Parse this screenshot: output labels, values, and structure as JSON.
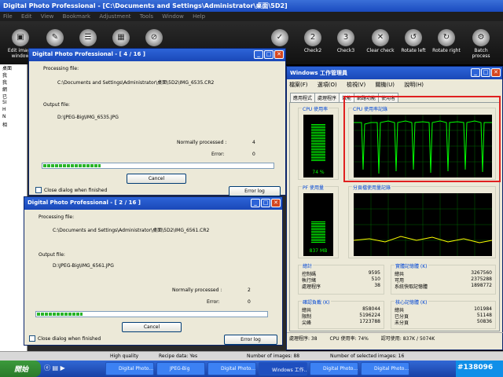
{
  "app": {
    "title": "Digital Photo Professional - [C:\\Documents and Settings\\Administrator\\桌面\\5D2]",
    "menu": [
      "File",
      "Edit",
      "View",
      "Bookmark",
      "Adjustment",
      "Tools",
      "Window",
      "Help"
    ]
  },
  "toolbar": {
    "edit_image": "Edit image window",
    "check2": "Check2",
    "check3": "Check3",
    "clear_check": "Clear check",
    "rotate_left": "Rotate left",
    "rotate_right": "Rotate right",
    "batch_process": "Batch process"
  },
  "folder_tree": [
    "桌面",
    "我",
    "我",
    "網",
    "已",
    "5I",
    "H",
    "N",
    "相"
  ],
  "dialog1": {
    "title": "Digital Photo Professional - [ 4 / 16 ]",
    "processing_label": "Processing file:",
    "processing_path": "C:\\Documents and Settings\\Administrator\\桌面\\5D2\\IMG_6535.CR2",
    "output_label": "Output file:",
    "output_path": "D:\\JPEG-Big\\IMG_6535.JPG",
    "normally_label": "Normally processed :",
    "normally_value": "4",
    "error_label": "Error:",
    "error_value": "0",
    "progress": 0.25,
    "cancel": "Cancel",
    "close_label": "Close dialog when finished",
    "error_log": "Error log"
  },
  "dialog2": {
    "title": "Digital Photo Professional - [ 2 / 16 ]",
    "processing_label": "Processing file:",
    "processing_path": "C:\\Documents and Settings\\Administrator\\桌面\\5D2\\IMG_6561.CR2",
    "output_label": "Output file:",
    "output_path": "D:\\JPEG-Big\\IMG_6561.JPG",
    "normally_label": "Normally processed :",
    "normally_value": "2",
    "error_label": "Error:",
    "error_value": "0",
    "progress": 0.2,
    "cancel": "Cancel",
    "close_label": "Close dialog when finished",
    "error_log": "Error log"
  },
  "taskmgr": {
    "title": "Windows 工作管理員",
    "menu": [
      "檔案(F)",
      "選項(O)",
      "檢視(V)",
      "關機(U)",
      "說明(H)"
    ],
    "tabs": [
      "應用程式",
      "處理程序",
      "效能",
      "網路功能",
      "使用者"
    ],
    "cpu_usage_label": "CPU 使用率",
    "cpu_usage_value": "74 %",
    "cpu_history_label": "CPU 使用率記錄",
    "pf_label": "PF 使用量",
    "pf_value": "837 MB",
    "pf_history_label": "分頁檔使用量記錄",
    "totals_label": "總計",
    "totals": [
      [
        "控制碼",
        "9595"
      ],
      [
        "執行緒",
        "510"
      ],
      [
        "處理程序",
        "38"
      ]
    ],
    "physical_label": "實體記憶體 (K)",
    "physical": [
      [
        "總共",
        "3267560"
      ],
      [
        "可用",
        "2375288"
      ],
      [
        "系統快取記憶體",
        "1898772"
      ]
    ],
    "commit_label": "確認負載 (K)",
    "commit": [
      [
        "總共",
        "858044"
      ],
      [
        "限制",
        "5196224"
      ],
      [
        "尖峰",
        "1723788"
      ]
    ],
    "kernel_label": "核心記憶體 (K)",
    "kernel": [
      [
        "總共",
        "101984"
      ],
      [
        "已分頁",
        "51148"
      ],
      [
        "未分頁",
        "50836"
      ]
    ],
    "status": [
      "處理程序: 38",
      "CPU 使用率: 74%",
      "認可使用: 837K / 5074K"
    ]
  },
  "dpp_status": {
    "quality": "High quality",
    "recipe": "Recipe data: Yes",
    "num_images": "Number of images: 88",
    "num_selected": "Number of selected images: 16"
  },
  "taskbar": {
    "start": "開始",
    "tasks": [
      "Digital Photo...",
      "JPEG-Big",
      "Digital Photo...",
      "Windows 工作...",
      "Digital Photo...",
      "Digital Photo..."
    ],
    "tray": "#138096"
  },
  "colors": {
    "accent": "#1b4bbf",
    "graph_green": "#00ff00",
    "highlight": "#e02020"
  }
}
